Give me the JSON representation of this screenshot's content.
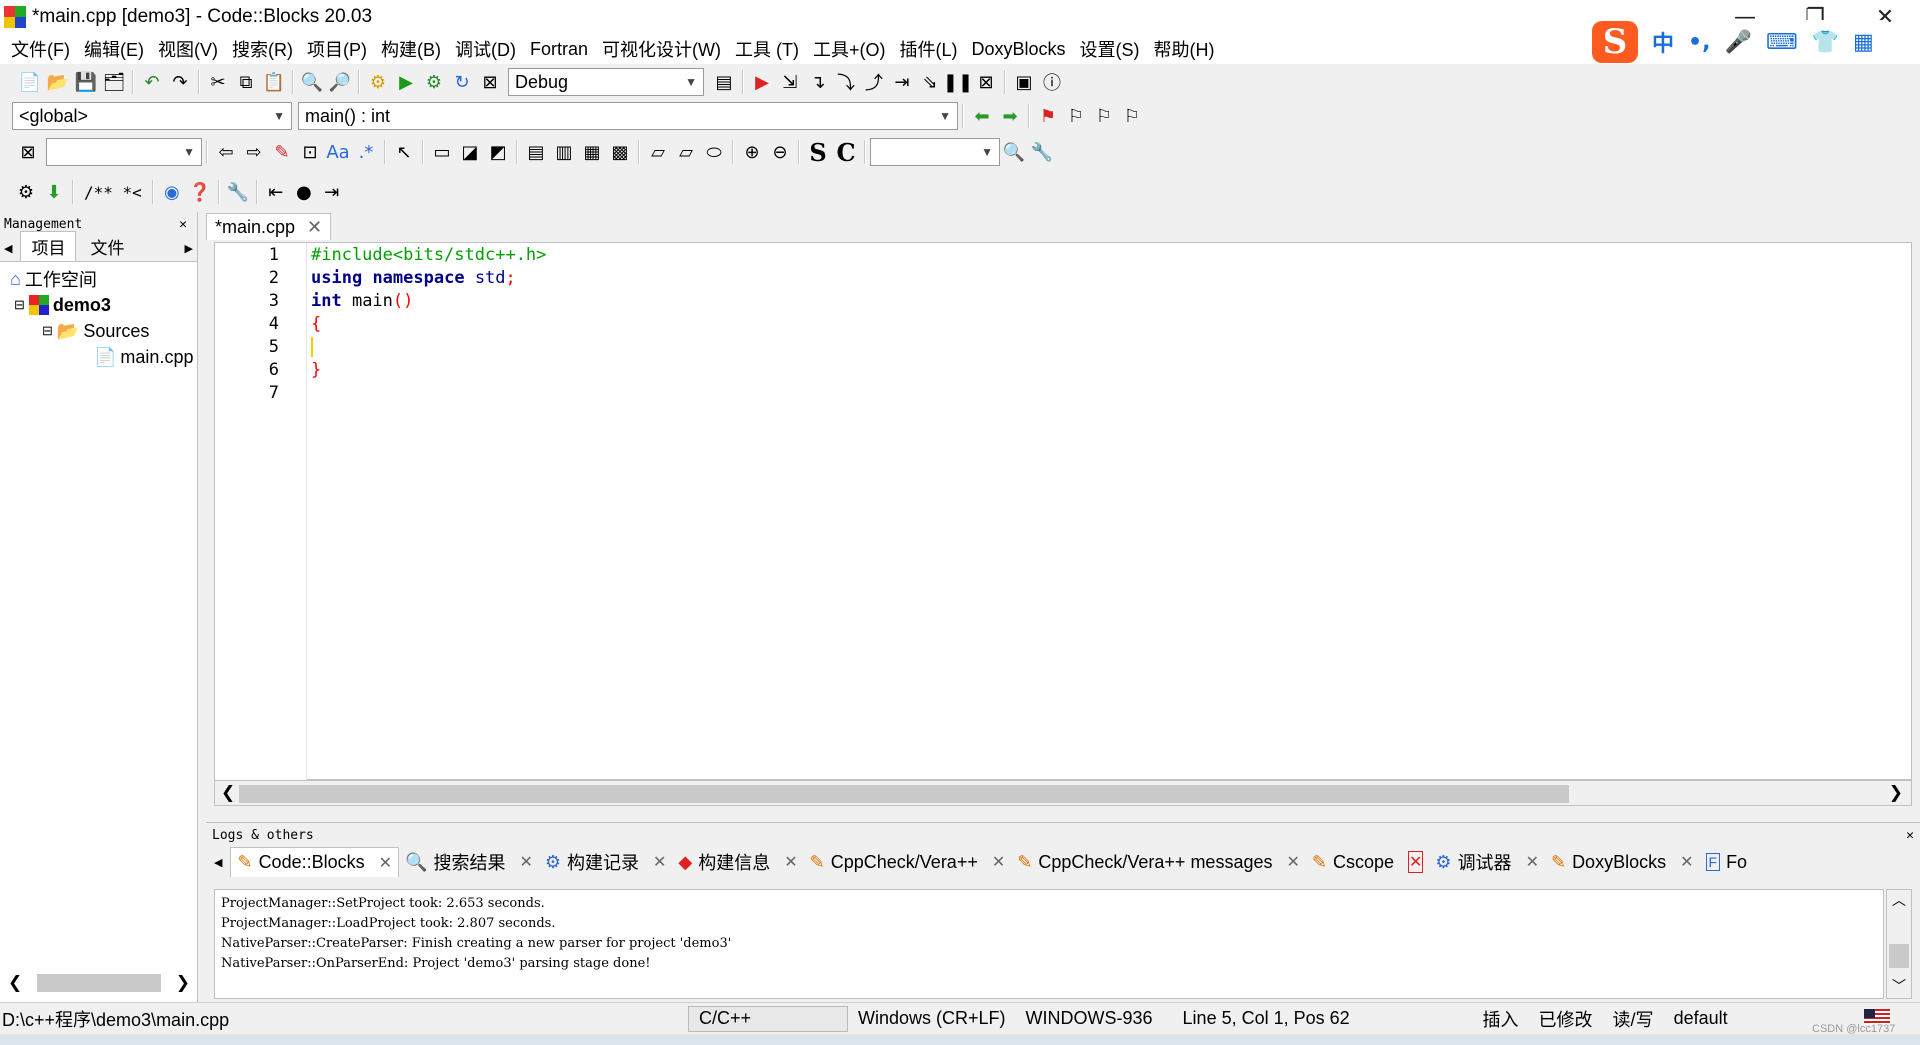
{
  "window": {
    "title": "*main.cpp [demo3] - Code::Blocks 20.03",
    "min": "—",
    "restore": "❐",
    "close": "✕"
  },
  "ime": {
    "logo": "S",
    "items": [
      "中",
      "•,",
      "🎤",
      "⌨",
      "👕",
      "▦"
    ]
  },
  "menu": [
    "文件(F)",
    "编辑(E)",
    "视图(V)",
    "搜索(R)",
    "项目(P)",
    "构建(B)",
    "调试(D)",
    "Fortran",
    "可视化设计(W)",
    "工具 (T)",
    "工具+(O)",
    "插件(L)",
    "DoxyBlocks",
    "设置(S)",
    "帮助(H)"
  ],
  "toolbar": {
    "build_target": "Debug",
    "scope": "<global>",
    "function": "main() : int",
    "s_label": "S",
    "c_label": "C",
    "comment_label": "/** *<"
  },
  "management": {
    "title": "Management",
    "tabs": [
      "项目",
      "文件"
    ],
    "tree": {
      "workspace": "工作空间",
      "project": "demo3",
      "folder": "Sources",
      "file": "main.cpp"
    }
  },
  "editor": {
    "tab": "*main.cpp",
    "lines": [
      {
        "n": "1",
        "code": "#include<bits/stdc++.h>"
      },
      {
        "n": "2",
        "code": "using namespace std;"
      },
      {
        "n": "3",
        "code": "int main()"
      },
      {
        "n": "4",
        "code": "{"
      },
      {
        "n": "5",
        "code": ""
      },
      {
        "n": "6",
        "code": "}"
      },
      {
        "n": "7",
        "code": ""
      }
    ]
  },
  "logs": {
    "title": "Logs & others",
    "tabs": [
      "Code::Blocks",
      "搜索结果",
      "构建记录",
      "构建信息",
      "CppCheck/Vera++",
      "CppCheck/Vera++ messages",
      "Cscope",
      "调试器",
      "DoxyBlocks",
      "Fo"
    ],
    "lines": [
      "ProjectManager::SetProject took: 2.653 seconds.",
      "ProjectManager::LoadProject took: 2.807 seconds.",
      "NativeParser::CreateParser: Finish creating a new parser for project 'demo3'",
      "NativeParser::OnParserEnd: Project 'demo3' parsing stage done!"
    ]
  },
  "status": {
    "path": "D:\\c++程序\\demo3\\main.cpp",
    "lang": "C/C++",
    "eol": "Windows (CR+LF)",
    "encoding": "WINDOWS-936",
    "position": "Line 5, Col 1, Pos 62",
    "insert": "插入",
    "modified": "已修改",
    "rw": "读/写",
    "mode": "default",
    "watermark": "CSDN @lcc1737"
  },
  "colors": {
    "keyword": "#00008b",
    "preproc": "#00a000",
    "operator": "#ff0000",
    "accent": "#1a6fd6"
  }
}
